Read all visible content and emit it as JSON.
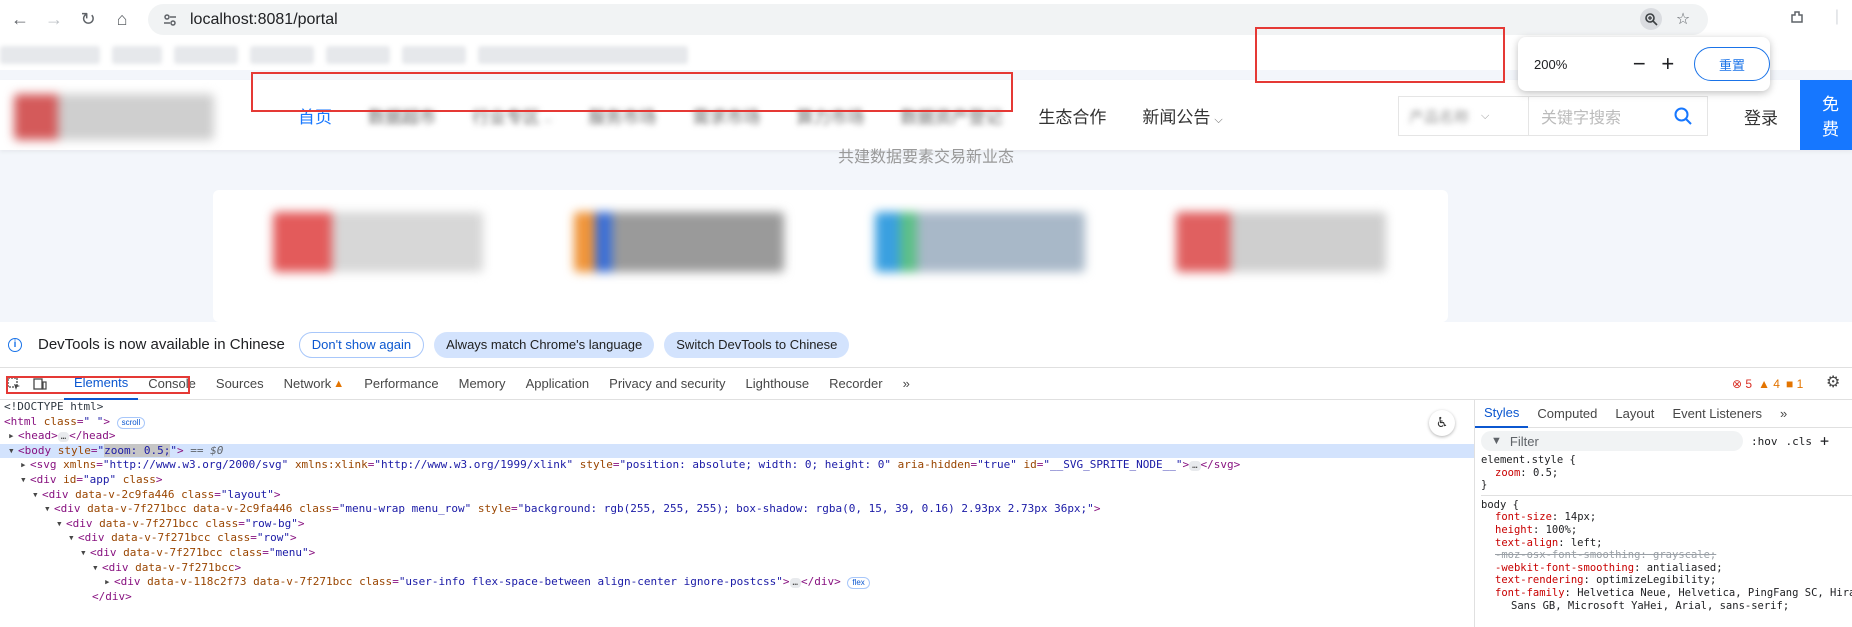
{
  "browser": {
    "url": "localhost:8081/portal"
  },
  "zoom_popup": {
    "level": "200%",
    "minus": "−",
    "plus": "+",
    "reset_label": "重置"
  },
  "site": {
    "menu": [
      {
        "label": "首页",
        "active": true
      },
      {
        "label": "数据超市",
        "blurred": true
      },
      {
        "label": "行业专区",
        "blurred": true,
        "caret": true
      },
      {
        "label": "服务市场",
        "blurred": true
      },
      {
        "label": "需求市场",
        "blurred": true
      },
      {
        "label": "算力市场",
        "blurred": true
      },
      {
        "label": "数据资产登记",
        "blurred": true
      },
      {
        "label": "生态合作"
      },
      {
        "label": "新闻公告",
        "caret": true
      }
    ],
    "select_placeholder": "产品名称",
    "search_placeholder": "关键字搜索",
    "login_label": "登录",
    "register_label": "免费",
    "slogan": "共建数据要素交易新业态"
  },
  "devtools": {
    "infobar": {
      "message": "DevTools is now available in Chinese",
      "btn_dont_show": "Don't show again",
      "btn_match": "Always match Chrome's language",
      "btn_switch": "Switch DevTools to Chinese"
    },
    "tabs": [
      "Elements",
      "Console",
      "Sources",
      "Network",
      "Performance",
      "Memory",
      "Application",
      "Privacy and security",
      "Lighthouse",
      "Recorder",
      "»"
    ],
    "counts": {
      "errors": "5",
      "warnings": "4",
      "issues": "1"
    },
    "styles_tabs": [
      "Styles",
      "Computed",
      "Layout",
      "Event Listeners",
      "»"
    ],
    "filter_placeholder": "Filter",
    "filter_opts": [
      ":hov",
      ".cls",
      "+"
    ],
    "colors": {
      "accent": "#0b57d0",
      "selected_row": "#d3e3fd",
      "red_outline": "#e53935"
    }
  }
}
